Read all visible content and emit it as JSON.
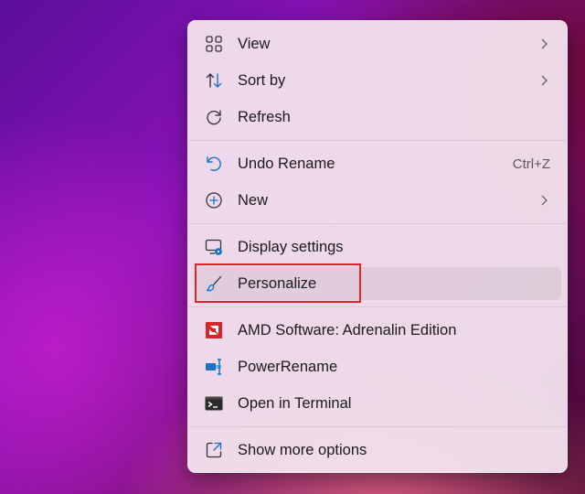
{
  "menu": {
    "items": [
      {
        "label": "View",
        "icon": "view-grid-icon",
        "has_submenu": true
      },
      {
        "label": "Sort by",
        "icon": "sort-arrows-icon",
        "has_submenu": true
      },
      {
        "label": "Refresh",
        "icon": "refresh-icon"
      },
      {
        "label": "Undo Rename",
        "icon": "undo-icon",
        "shortcut": "Ctrl+Z"
      },
      {
        "label": "New",
        "icon": "plus-circle-icon",
        "has_submenu": true
      },
      {
        "label": "Display settings",
        "icon": "display-settings-icon"
      },
      {
        "label": "Personalize",
        "icon": "paintbrush-icon",
        "highlighted": true
      },
      {
        "label": "AMD Software: Adrenalin Edition",
        "icon": "amd-logo-icon"
      },
      {
        "label": "PowerRename",
        "icon": "powerrename-icon"
      },
      {
        "label": "Open in Terminal",
        "icon": "terminal-icon"
      },
      {
        "label": "Show more options",
        "icon": "show-more-options-icon"
      }
    ]
  },
  "colors": {
    "annotation_box": "#e0242a",
    "accent_blue": "#1a73c7",
    "amd_red": "#d8232a"
  }
}
